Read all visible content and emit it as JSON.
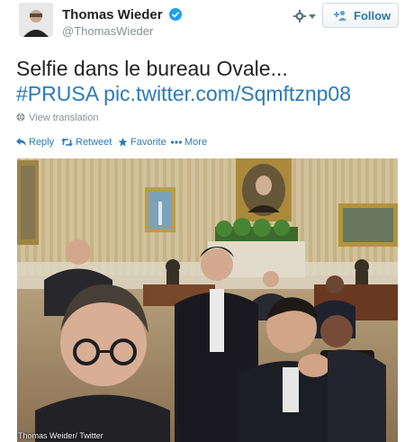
{
  "user": {
    "name": "Thomas Wieder",
    "handle": "@ThomasWieder"
  },
  "buttons": {
    "follow_label": "Follow"
  },
  "tweet": {
    "text_plain": "Selfie dans le bureau Ovale...",
    "hashtag": "#PRUSA",
    "link": "pic.twitter.com/Sqmftznp08"
  },
  "translate_label": "View translation",
  "actions": {
    "reply": "Reply",
    "retweet": "Retweet",
    "favorite": "Favorite",
    "more": "More"
  },
  "photo_caption": "Thomas Weider/ Twitter",
  "colors": {
    "link": "#2b7bb9",
    "text": "#222222",
    "muted": "#8a8f94",
    "verified": "#1da1f2"
  },
  "icons": [
    "gear-icon",
    "chevron-down-icon",
    "verified-icon",
    "add-user-icon",
    "reply-icon",
    "retweet-icon",
    "star-icon",
    "more-icon",
    "translate-icon"
  ]
}
